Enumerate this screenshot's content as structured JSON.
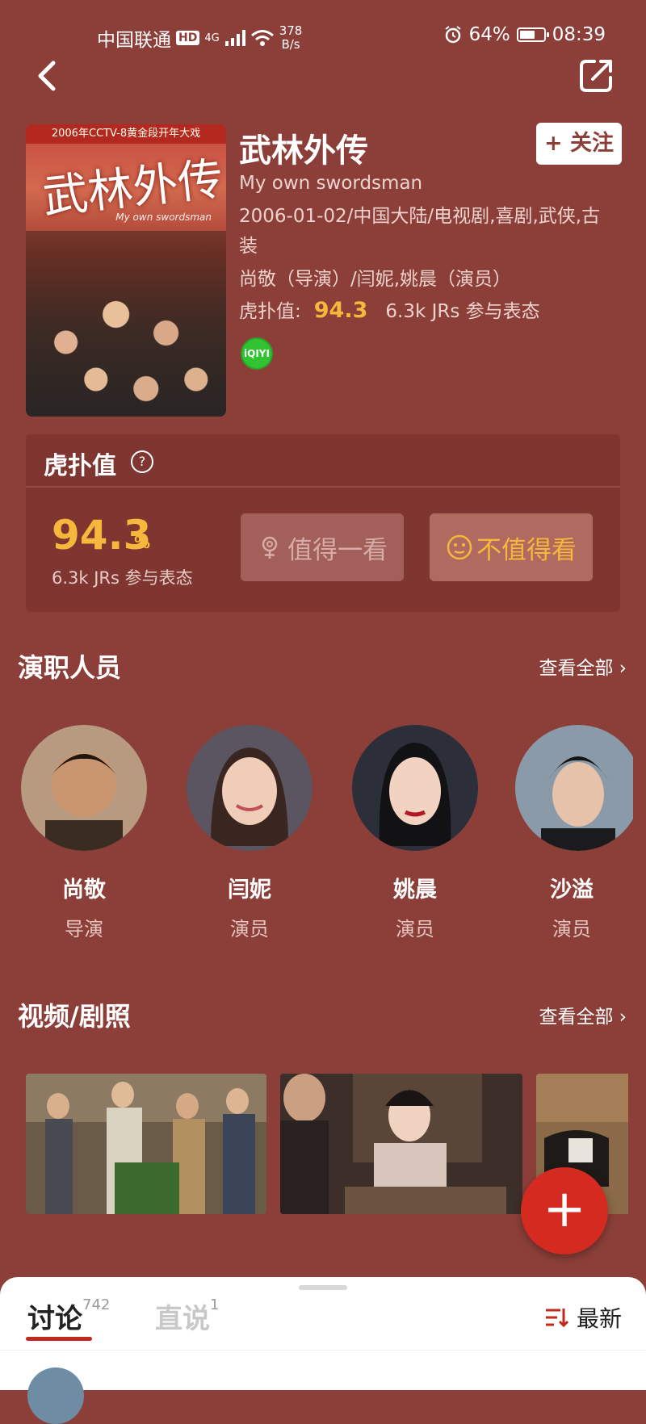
{
  "status_bar": {
    "carrier": "中国联通",
    "hd_badge": "HD",
    "network": "4G",
    "speed_value": "378",
    "speed_unit": "B/s",
    "battery": "64%",
    "battery_level": 0.64,
    "time": "08:39"
  },
  "movie": {
    "title": "武林外传",
    "english_title": "My own swordsman",
    "info": "2006-01-02/中国大陆/电视剧,喜剧,武侠,古装",
    "crew": "尚敬（导演）/闫妮,姚晨（演员）",
    "score_label": "虎扑值:",
    "score": "94.3",
    "participants": "6.3k JRs 参与表态",
    "follow_button": "+ 关注",
    "platform_icon": "iQIYI",
    "poster_topbar": "2006年CCTV-8黄金段开年大戏",
    "poster_title": "武林外传",
    "poster_subtitle": "My own swordsman"
  },
  "rating": {
    "title": "虎扑值",
    "help_icon": "?",
    "score": "94.3",
    "percent": "%",
    "participants": "6.3k JRs 参与表态",
    "worth_button": "值得一看",
    "not_worth_button": "不值得看"
  },
  "cast_section": {
    "title": "演职人员",
    "see_all": "查看全部",
    "members": [
      {
        "name": "尚敬",
        "role": "导演",
        "color": "#b89a80"
      },
      {
        "name": "闫妮",
        "role": "演员",
        "color": "#5a5560"
      },
      {
        "name": "姚晨",
        "role": "演员",
        "color": "#2c2f3a"
      },
      {
        "name": "沙溢",
        "role": "演员",
        "color": "#8a9aa8"
      }
    ]
  },
  "media_section": {
    "title": "视频/剧照",
    "see_all": "查看全部"
  },
  "fab": {
    "label": "+"
  },
  "bottom_tabs": {
    "discussion": "讨论",
    "discussion_count": "742",
    "direct": "直说",
    "direct_count": "1",
    "sort": "最新"
  },
  "colors": {
    "background": "#8c3f39",
    "accent": "#f5b73c",
    "fab": "#d42a1f"
  }
}
